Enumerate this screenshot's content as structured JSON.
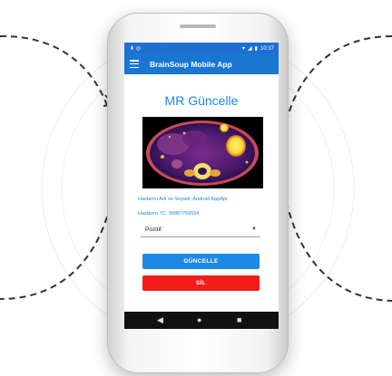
{
  "status_bar": {
    "time": "10:37"
  },
  "app_bar": {
    "title": "BrainSoup Mobile App"
  },
  "page": {
    "title": "MR Güncelle",
    "patient_name_line": "Hastanın Adı ve Soyadı: Android AppApi",
    "patient_tc_line": "Hastanın TC: 99887766554",
    "result_select": {
      "value": "Pozitif"
    },
    "update_button": "GÜNCELLE",
    "delete_button": "SİL"
  },
  "nav_bar": {
    "back": "◀",
    "home": "●",
    "recents": "■"
  },
  "colors": {
    "primary": "#1976d2",
    "accent_text": "#1e88e5",
    "danger": "#f21c1c"
  }
}
